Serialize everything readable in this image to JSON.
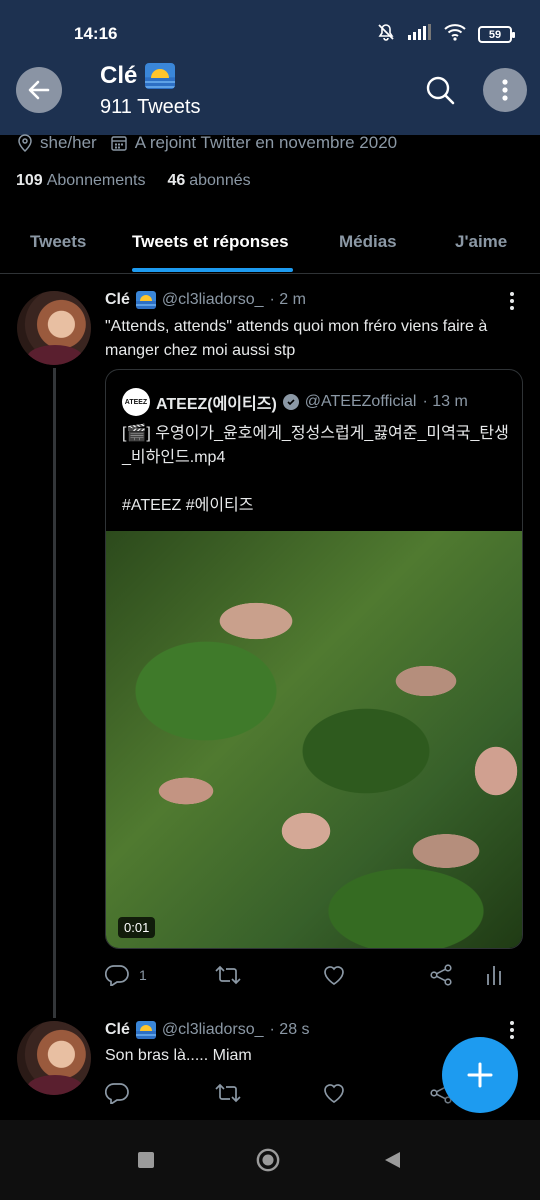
{
  "status_bar": {
    "time": "14:16",
    "battery": "59",
    "icons": [
      "mute-icon",
      "signal-icon",
      "wifi-icon",
      "battery-icon"
    ]
  },
  "header": {
    "name": "Clé",
    "name_emoji": "sunrise-over-sea-emoji",
    "tweet_count": "911 Tweets",
    "color": "#1d3150"
  },
  "profile": {
    "pronouns": "she/her",
    "joined": "A rejoint Twitter en novembre 2020",
    "following_count": "109",
    "following_label": "Abonnements",
    "followers_count": "46",
    "followers_label": "abonnés"
  },
  "tabs": [
    {
      "label": "Tweets",
      "active": false
    },
    {
      "label": "Tweets et réponses",
      "active": true
    },
    {
      "label": "Médias",
      "active": false
    },
    {
      "label": "J'aime",
      "active": false
    }
  ],
  "tweets": [
    {
      "name": "Clé",
      "handle": "@cl3liadorso_",
      "time": "· 2 m",
      "text": "\"Attends, attends\" attends quoi mon fréro viens faire à manger chez moi aussi stp",
      "quote": {
        "name": "ATEEZ(에이티즈)",
        "handle": "@ATEEZofficial",
        "time": "· 13 m",
        "logo_text": "ATEEZ",
        "text": "[🎬] 우영이가_윤호에게_정성스럽게_끓여준_미역국_탄생_비하인드.mp4",
        "hashtags": "#ATEEZ #에이티즈",
        "video_duration": "0:01"
      },
      "reply_count": "1"
    },
    {
      "name": "Clé",
      "handle": "@cl3liadorso_",
      "time": "· 28 s",
      "text": "Son bras là..... Miam"
    }
  ],
  "accent_color": "#1d9bf0"
}
